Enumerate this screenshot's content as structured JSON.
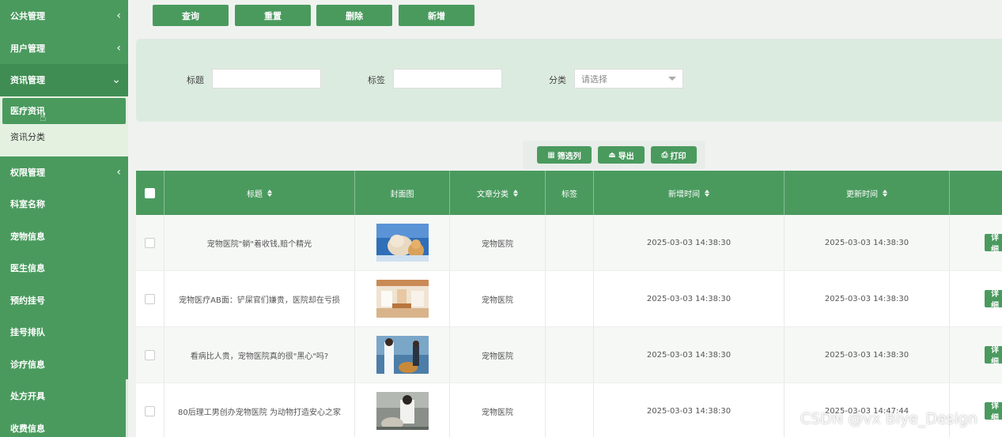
{
  "sidebar": {
    "groups": [
      {
        "label": "公共管理",
        "chev": "‹"
      },
      {
        "label": "用户管理",
        "chev": "‹"
      },
      {
        "label": "资讯管理",
        "chev": "⌄"
      }
    ],
    "sub_items": [
      {
        "label": "医疗资讯"
      },
      {
        "label": "资讯分类"
      }
    ],
    "permission": {
      "label": "权限管理",
      "chev": "‹"
    },
    "items": [
      {
        "label": "科室名称"
      },
      {
        "label": "宠物信息"
      },
      {
        "label": "医生信息"
      },
      {
        "label": "预约挂号"
      },
      {
        "label": "挂号排队"
      },
      {
        "label": "诊疗信息"
      },
      {
        "label": "处方开具"
      },
      {
        "label": "收费信息"
      }
    ]
  },
  "toolbar": {
    "query_label": "查询",
    "reset_label": "重置",
    "delete_label": "删除",
    "add_label": "新增"
  },
  "search": {
    "title_label": "标题",
    "tag_label": "标签",
    "category_label": "分类",
    "category_placeholder": "请选择"
  },
  "actions": {
    "filter_label": "筛选列",
    "export_label": "导出",
    "print_label": "打印"
  },
  "table": {
    "headers": {
      "title": "标题",
      "cover": "封面图",
      "category": "文章分类",
      "tag": "标签",
      "created": "新增时间",
      "updated": "更新时间"
    },
    "detail_label": "详细",
    "rows": [
      {
        "title": "宠物医院\"躺\"着收钱,赔个精光",
        "category": "宠物医院",
        "tag": "",
        "created": "2025-03-03 14:38:30",
        "updated": "2025-03-03 14:38:30"
      },
      {
        "title": "宠物医疗AB面：铲屎官们嫌贵，医院却在亏损",
        "category": "宠物医院",
        "tag": "",
        "created": "2025-03-03 14:38:30",
        "updated": "2025-03-03 14:38:30"
      },
      {
        "title": "看病比人贵，宠物医院真的很\"黑心\"吗?",
        "category": "宠物医院",
        "tag": "",
        "created": "2025-03-03 14:38:30",
        "updated": "2025-03-03 14:38:30"
      },
      {
        "title": "80后理工男创办宠物医院 为动物打造安心之家",
        "category": "宠物医院",
        "tag": "",
        "created": "2025-03-03 14:38:30",
        "updated": "2025-03-03 14:47:44"
      }
    ]
  },
  "watermark": "CSDN @vx Biye_Design",
  "colors": {
    "accent": "#4a9a5e",
    "panel": "#dcebdf",
    "submenu": "#e4f1e0"
  }
}
